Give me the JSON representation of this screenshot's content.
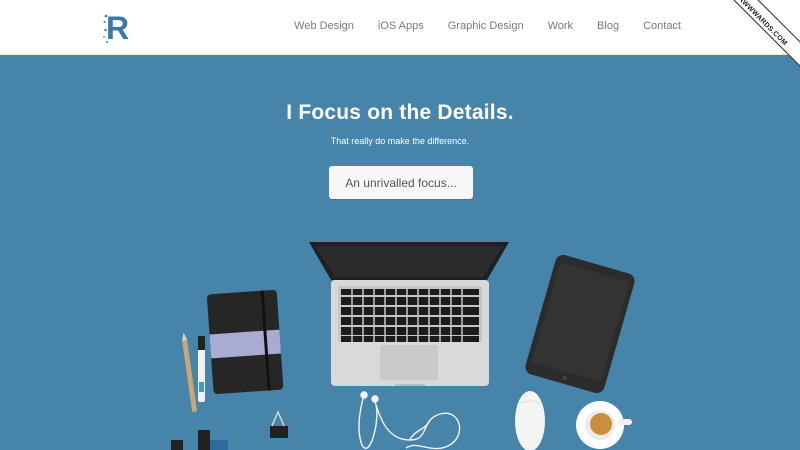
{
  "header": {
    "logo_letter": "R",
    "nav": [
      {
        "label": "Web Design"
      },
      {
        "label": "iOS Apps"
      },
      {
        "label": "Graphic Design"
      },
      {
        "label": "Work"
      },
      {
        "label": "Blog"
      },
      {
        "label": "Contact"
      }
    ]
  },
  "ribbon": {
    "label": "AWWWARDS.COM"
  },
  "hero": {
    "title": "I Focus on the Details.",
    "subtitle": "That really do make the difference.",
    "cta_label": "An unrivalled focus..."
  },
  "colors": {
    "background": "#4684aa",
    "header_bg": "#ffffff",
    "logo": "#3a7aa0",
    "nav_text": "#7a7a7a",
    "device_dark": "#2a2a2a",
    "device_silver": "#d6d6d6"
  },
  "icons": {
    "logo": "r-logo-icon",
    "laptop": "laptop-icon",
    "tablet": "tablet-icon",
    "notebook": "notebook-icon",
    "pencil": "pencil-icon",
    "pen": "pen-icon",
    "earphones": "earphones-icon",
    "mouse": "mouse-icon",
    "coffee": "coffee-cup-icon",
    "clip": "binder-clip-icon"
  }
}
